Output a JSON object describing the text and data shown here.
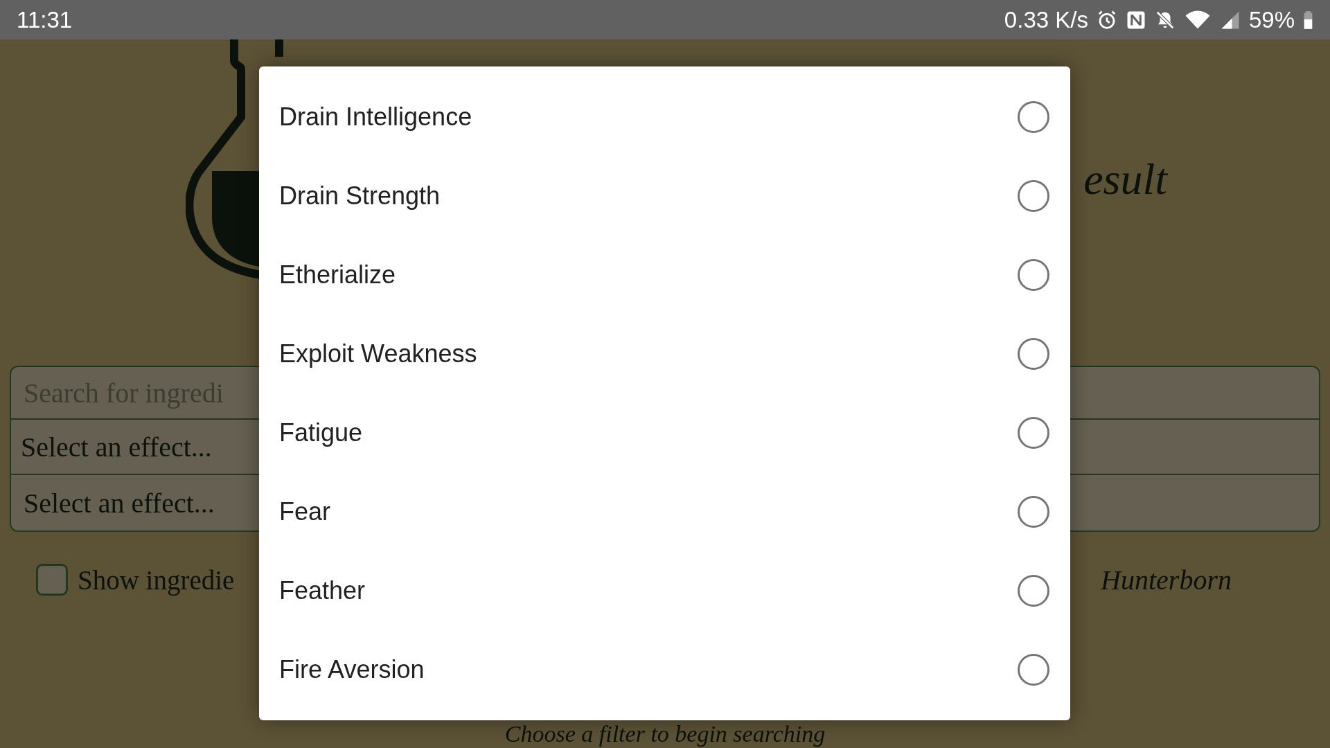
{
  "status_bar": {
    "time": "11:31",
    "net_speed": "0.33 K/s",
    "battery": "59%"
  },
  "page": {
    "title": "esult",
    "search": {
      "placeholder": "Search for ingredi"
    },
    "effect_selects": [
      "Select an effect...",
      "Select an effect..."
    ],
    "checkbox": {
      "label": "Show ingredie",
      "checked": false
    },
    "credit": "Hunterborn",
    "hint": "Choose a filter to begin searching"
  },
  "dialog": {
    "options": [
      {
        "label": "Drain Intelligence",
        "selected": false
      },
      {
        "label": "Drain Strength",
        "selected": false
      },
      {
        "label": "Etherialize",
        "selected": false
      },
      {
        "label": "Exploit Weakness",
        "selected": false
      },
      {
        "label": "Fatigue",
        "selected": false
      },
      {
        "label": "Fear",
        "selected": false
      },
      {
        "label": "Feather",
        "selected": false
      },
      {
        "label": "Fire Aversion",
        "selected": false
      }
    ]
  }
}
